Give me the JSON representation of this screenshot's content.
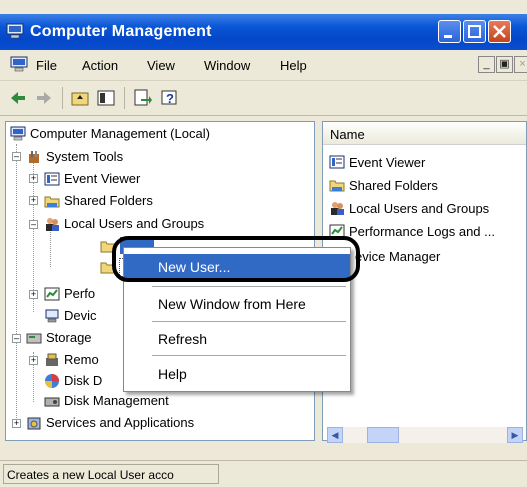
{
  "window": {
    "title": "Computer Management"
  },
  "menu": [
    "File",
    "Action",
    "View",
    "Window",
    "Help"
  ],
  "tree": {
    "root": "Computer Management (Local)",
    "system_tools": "System Tools",
    "event_viewer": "Event Viewer",
    "shared_folders": "Shared Folders",
    "local_users": "Local Users and Groups",
    "perf_partial": "Perfo",
    "device_partial": "Devic",
    "storage": "Storage",
    "removable_partial": "Remo",
    "disk_def_partial": "Disk D",
    "disk_mgmt": "Disk Management",
    "services": "Services and Applications"
  },
  "list": {
    "column": "Name",
    "items": [
      "Event Viewer",
      "Shared Folders",
      "Local Users and Groups",
      "Performance Logs and ...",
      "evice Manager"
    ]
  },
  "context_menu": {
    "new_user": "New User...",
    "new_window": "New Window from Here",
    "refresh": "Refresh",
    "help": "Help"
  },
  "status": "Creates a new Local User acco"
}
